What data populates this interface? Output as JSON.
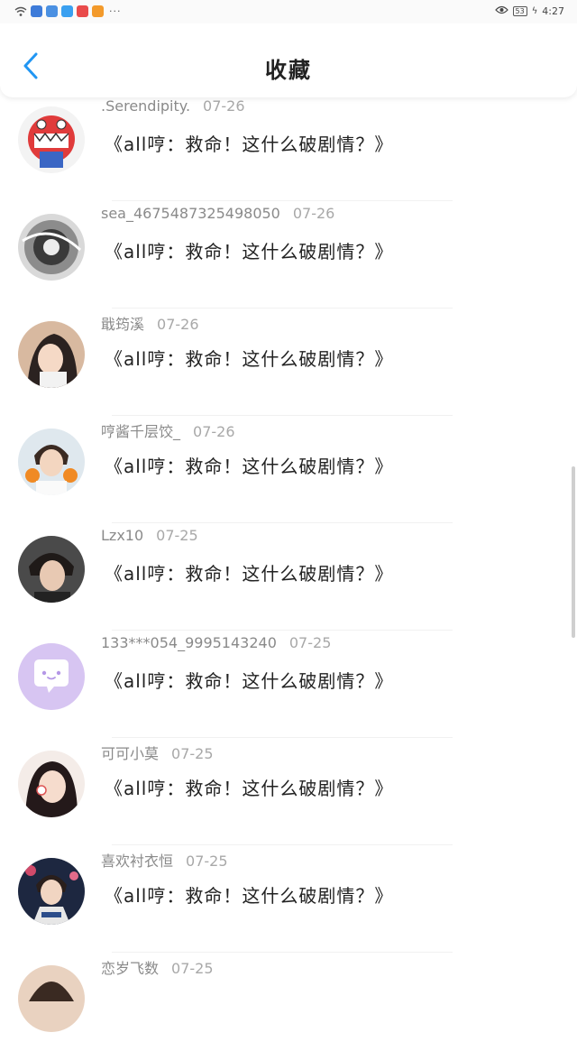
{
  "status_bar": {
    "icons": [
      "wifi-icon",
      "app-icon-blue",
      "app-icon-blue",
      "app-icon-blue",
      "app-icon-red",
      "app-icon-orange"
    ],
    "more": "···",
    "battery": "53",
    "time": "4:27"
  },
  "header": {
    "title": "收藏",
    "back_icon": "chevron-left-icon"
  },
  "colors": {
    "accent": "#2196f3",
    "meta_text": "#8a8a8a",
    "body_text": "#222222"
  },
  "items": [
    {
      "user": ".Serendipity.",
      "date": "07-26",
      "text": "《all哼：救命！这什么破剧情？》"
    },
    {
      "user": "sea_4675487325498050",
      "date": "07-26",
      "text": "《all哼：救命！这什么破剧情？》"
    },
    {
      "user": "戢筠溪",
      "date": "07-26",
      "text": "《all哼：救命！这什么破剧情？》"
    },
    {
      "user": "哼酱千层饺_",
      "date": "07-26",
      "text": "《all哼：救命！这什么破剧情？》"
    },
    {
      "user": "Lzx10",
      "date": "07-25",
      "text": "《all哼：救命！这什么破剧情？》"
    },
    {
      "user": "133***054_9995143240",
      "date": "07-25",
      "text": "《all哼：救命！这什么破剧情？》"
    },
    {
      "user": "可可小莫",
      "date": "07-25",
      "text": "《all哼：救命！这什么破剧情？》"
    },
    {
      "user": "喜欢衬衣恒",
      "date": "07-25",
      "text": "《all哼：救命！这什么破剧情？》"
    },
    {
      "user": "恋岁飞数",
      "date": "07-25",
      "text": ""
    }
  ]
}
